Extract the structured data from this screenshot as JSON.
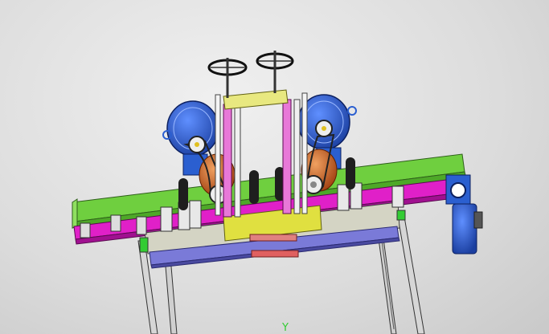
{
  "viewport": {
    "background": "#dcdcdc",
    "axis_label": "Y",
    "axis_color": "#33cc33"
  },
  "model": {
    "description_visible": false,
    "colors": {
      "frame_green": "#6fcf3f",
      "rail_magenta": "#e020c8",
      "plate_blue": "#7a7ad8",
      "motor_blue": "#2b5fd0",
      "pulley_orange": "#d8702a",
      "clamp_yellow": "#e0e040",
      "roller_black": "#1e1e1e",
      "grey_plate": "#c8c8b8",
      "leg_grey": "#d0d0d0",
      "accent_red": "#e06060"
    },
    "icons": [
      "handwheel-icon",
      "motor-icon",
      "gear-motor-icon",
      "roller-icon",
      "pulley-icon"
    ]
  }
}
